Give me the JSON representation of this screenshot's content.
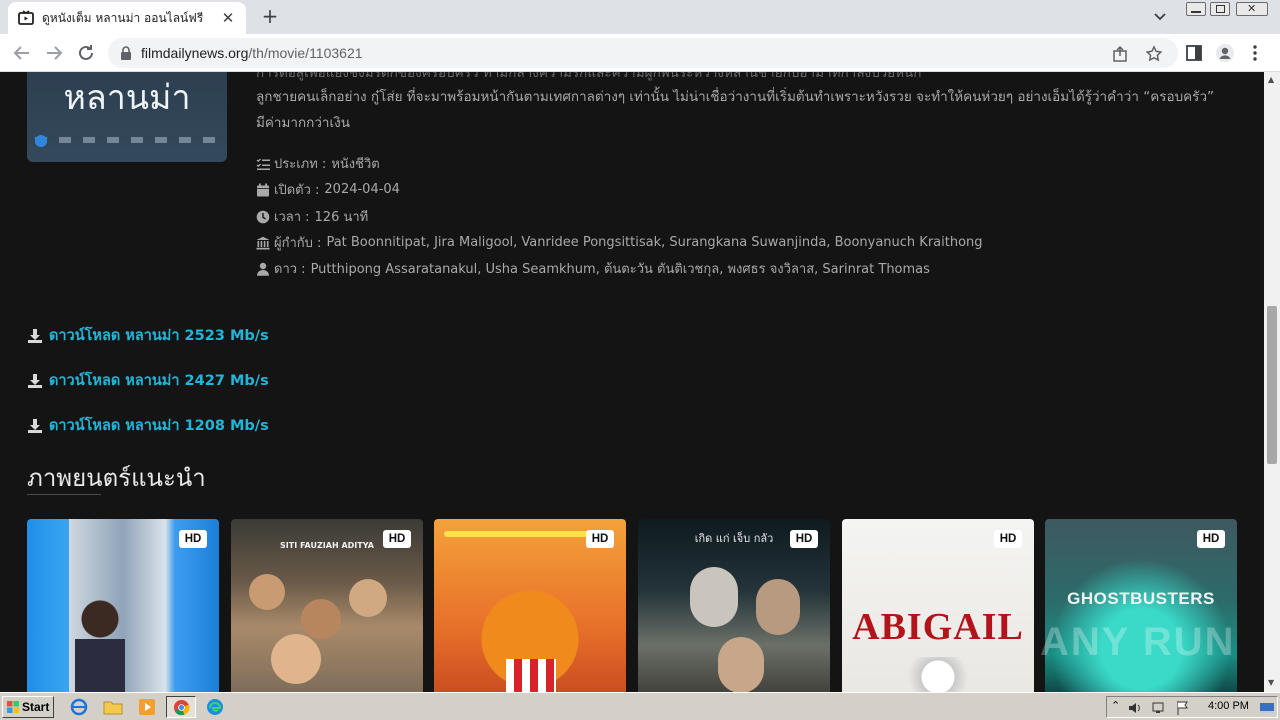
{
  "browser": {
    "tab_title": "ดูหนังเต็ม หลานม่า ออนไลน์ฟรี",
    "url_domain": "filmdailynews.org",
    "url_path": "/th/movie/1103621"
  },
  "movie": {
    "poster_title": "หลานม่า",
    "synopsis_line0": "การต่อสู้เพื่อแย่งชิงมรดกของครอบครัว ท่ามกลางความรักและความผูกพันระหว่างหลานชายกับอาม่าที่กำลังป่วยหนัก",
    "synopsis_line1": "ลูกชายคนเล็กอย่าง กู๋โส่ย ที่จะมาพร้อมหน้ากันตามเทศกาลต่างๆ เท่านั้น ไม่น่าเชื่อว่างานที่เริ่มต้นทำเพราะหวังรวย จะทำให้คนห่วยๆ อย่างเอ็มได้รู้ว่าคำว่า “ครอบครัว”",
    "synopsis_line2": "มีค่ามากกว่าเงิน",
    "genre_label": "ประเภท :",
    "genre_value": "หนังชีวิต",
    "release_label": "เปิดตัว :",
    "release_value": "2024-04-04",
    "runtime_label": "เวลา :",
    "runtime_value": "126 นาที",
    "director_label": "ผู้กำกับ :",
    "director_value": "Pat Boonnitipat, Jira Maligool, Vanridee Pongsittisak, Surangkana Suwanjinda, Boonyanuch Kraithong",
    "cast_label": "ดาว :",
    "cast_value": "Putthipong Assaratanakul, Usha Seamkhum, ต้นตะวัน ตันติเวชกุล, พงศธร จงวิลาส, Sarinrat Thomas"
  },
  "downloads": [
    {
      "label": "ดาวน์โหลด หลานม่า 2523 Mb/s"
    },
    {
      "label": "ดาวน์โหลด หลานม่า 2427 Mb/s"
    },
    {
      "label": "ดาวน์โหลด หลานม่า 1208 Mb/s"
    }
  ],
  "recommended": {
    "title": "ภาพยนตร์แนะนำ",
    "cards": [
      {
        "badge": "HD",
        "caption": ""
      },
      {
        "badge": "HD",
        "caption": "SITI FAUZIAH   ADITYA"
      },
      {
        "badge": "HD",
        "caption": ""
      },
      {
        "badge": "HD",
        "caption": "เกิด แก่ เจ็บ กลัว"
      },
      {
        "badge": "HD",
        "caption": "ABIGAIL"
      },
      {
        "badge": "HD",
        "caption": "GHOSTBUSTERS"
      }
    ]
  },
  "watermark": "ANY RUN",
  "taskbar": {
    "start_label": "Start",
    "clock": "4:00 PM"
  },
  "colors": {
    "page_bg": "#141414",
    "link": "#1fb6d9",
    "text_muted": "#a9a9a9"
  }
}
